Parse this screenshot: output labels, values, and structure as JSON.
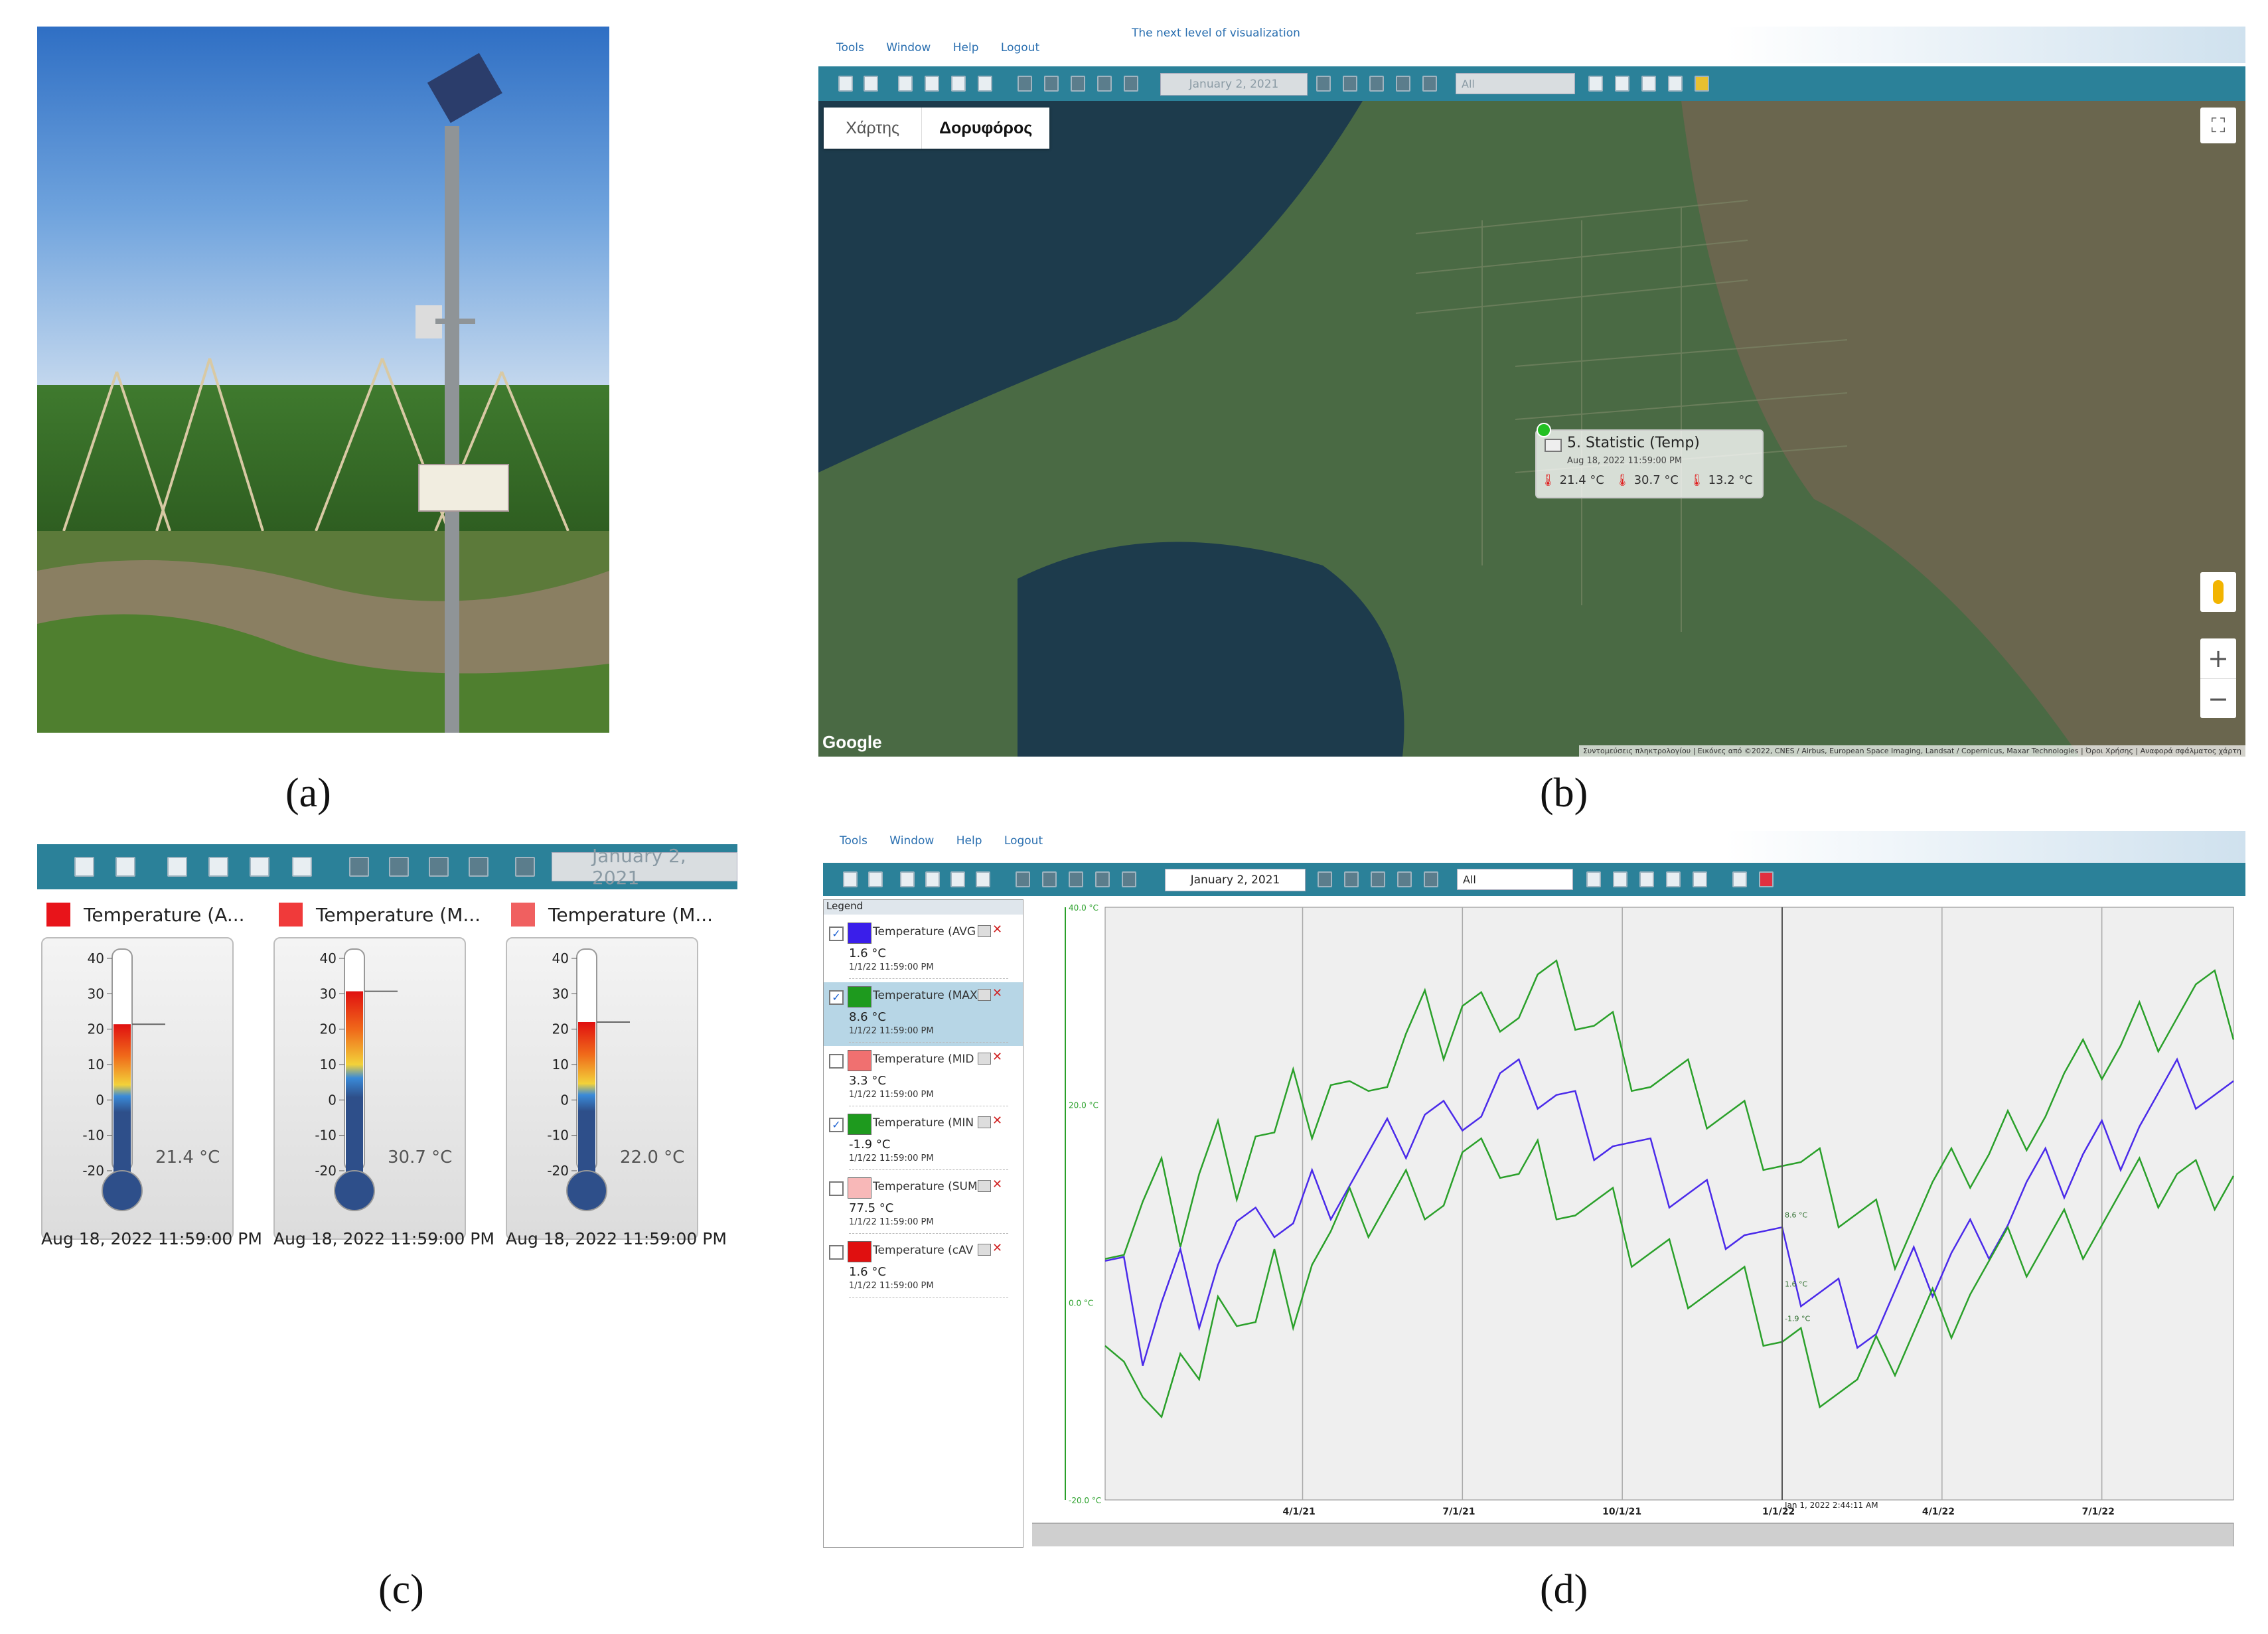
{
  "captions": {
    "a": "(a)",
    "b": "(b)",
    "c": "(c)",
    "d": "(d)"
  },
  "menu": {
    "tools": "Tools",
    "window": "Window",
    "help": "Help",
    "logout": "Logout"
  },
  "tagline": "The next level of visualization",
  "toolbar": {
    "date": "January 2, 2021",
    "filter": "All"
  },
  "map": {
    "tabs": [
      "Χάρτης",
      "Δορυφόρος"
    ],
    "popup": {
      "title": "5. Statistic (Temp)",
      "timestamp": "Aug 18, 2022 11:59:00 PM",
      "values": [
        "21.4 °C",
        "30.7 °C",
        "13.2 °C"
      ]
    },
    "google": "Google",
    "attribution": "Συντομεύσεις πληκτρολογίου | Εικόνες από ©2022, CNES / Airbus, European Space Imaging, Landsat / Copernicus, Maxar Technologies | Όροι Χρήσης | Αναφορά σφάλματος χάρτη",
    "zoom_in": "+",
    "zoom_out": "−",
    "fullscreen": "⛶",
    "colors": {
      "sea": "#1d3b4c",
      "land": "#4a6a44",
      "mountain": "#6e6650"
    }
  },
  "thermometers": {
    "scale": [
      "40",
      "30",
      "20",
      "10",
      "0",
      "-10",
      "-20"
    ],
    "items": [
      {
        "label": "Temperature (A...",
        "value": "21.4 °C",
        "level": 21.4,
        "timestamp": "Aug 18, 2022 11:59:00 PM",
        "color": "#e8141a"
      },
      {
        "label": "Temperature (M...",
        "value": "30.7 °C",
        "level": 30.7,
        "timestamp": "Aug 18, 2022 11:59:00 PM",
        "color": "#f03a3a"
      },
      {
        "label": "Temperature (M...",
        "value": "22.0 °C",
        "level": 22.0,
        "timestamp": "Aug 18, 2022 11:59:00 PM",
        "color": "#f06060"
      }
    ]
  },
  "legend": {
    "title": "Legend",
    "items": [
      {
        "name": "Temperature (AVG",
        "value": "1.6 °C",
        "ts": "1/1/22 11:59:00 PM",
        "color": "#3a1eea",
        "checked": true
      },
      {
        "name": "Temperature (MAX",
        "value": "8.6 °C",
        "ts": "1/1/22 11:59:00 PM",
        "color": "#1e9a1e",
        "checked": true,
        "selected": true
      },
      {
        "name": "Temperature (MID",
        "value": "3.3 °C",
        "ts": "1/1/22 11:59:00 PM",
        "color": "#f07070",
        "checked": false
      },
      {
        "name": "Temperature (MIN",
        "value": "-1.9 °C",
        "ts": "1/1/22 11:59:00 PM",
        "color": "#1e9a1e",
        "checked": true
      },
      {
        "name": "Temperature (SUM",
        "value": "77.5 °C",
        "ts": "1/1/22 11:59:00 PM",
        "color": "#f8b8b8",
        "checked": false
      },
      {
        "name": "Temperature (cAV",
        "value": "1.6 °C",
        "ts": "1/1/22 11:59:00 PM",
        "color": "#e01010",
        "checked": false
      }
    ]
  },
  "chart_data": {
    "type": "line",
    "ylim": [
      -20,
      40
    ],
    "yticks": [
      "40.0 °C",
      "20.0 °C",
      "0.0 °C",
      "-20.0 °C"
    ],
    "xticks": [
      "4/1/21",
      "7/1/21",
      "10/1/21",
      "1/1/22",
      "4/1/22",
      "7/1/22"
    ],
    "cursor_label": "Jan 1, 2022 2:44:11 AM",
    "cursor_values": [
      "8.6 °C",
      "1.6 °C",
      "-1.9 °C"
    ],
    "series": [
      {
        "color": "#2aa02a",
        "values": [
          8,
          6,
          9,
          11,
          8,
          13,
          16,
          14,
          18,
          16,
          20,
          19,
          22,
          20,
          25,
          23,
          26,
          28,
          27,
          30,
          29,
          31,
          30,
          32,
          31,
          30,
          28,
          27,
          25,
          23,
          22,
          21,
          20,
          19,
          18,
          17,
          15,
          13,
          12,
          10,
          9,
          8,
          7,
          9,
          11,
          12,
          14,
          15,
          17,
          19,
          20,
          22,
          23,
          25,
          26,
          28,
          29,
          30,
          31,
          30,
          29
        ]
      },
      {
        "color": "#4a2aea",
        "values": [
          3,
          1,
          -4,
          0,
          3,
          1,
          5,
          7,
          6,
          9,
          8,
          11,
          12,
          13,
          14,
          15,
          17,
          19,
          18,
          21,
          20,
          22,
          21,
          22,
          21,
          19,
          18,
          17,
          15,
          13,
          12,
          11,
          10,
          9,
          8,
          6,
          4,
          2,
          1,
          0,
          -1,
          -2,
          0,
          2,
          3,
          5,
          6,
          8,
          9,
          11,
          12,
          13,
          15,
          16,
          17,
          19,
          20,
          21,
          22,
          21,
          20
        ]
      },
      {
        "color": "#2aa02a",
        "values": [
          -2,
          -6,
          -12,
          -8,
          -4,
          -9,
          -3,
          0,
          -2,
          3,
          1,
          5,
          6,
          8,
          9,
          10,
          11,
          12,
          11,
          14,
          13,
          15,
          13,
          14,
          12,
          10,
          9,
          8,
          6,
          5,
          4,
          3,
          2,
          1,
          0,
          -2,
          -4,
          -5,
          -7,
          -8,
          -9,
          -7,
          -5,
          -3,
          -1,
          0,
          2,
          3,
          4,
          5,
          6,
          7,
          8,
          9,
          10,
          11,
          12,
          13,
          12,
          13,
          14
        ]
      }
    ]
  }
}
